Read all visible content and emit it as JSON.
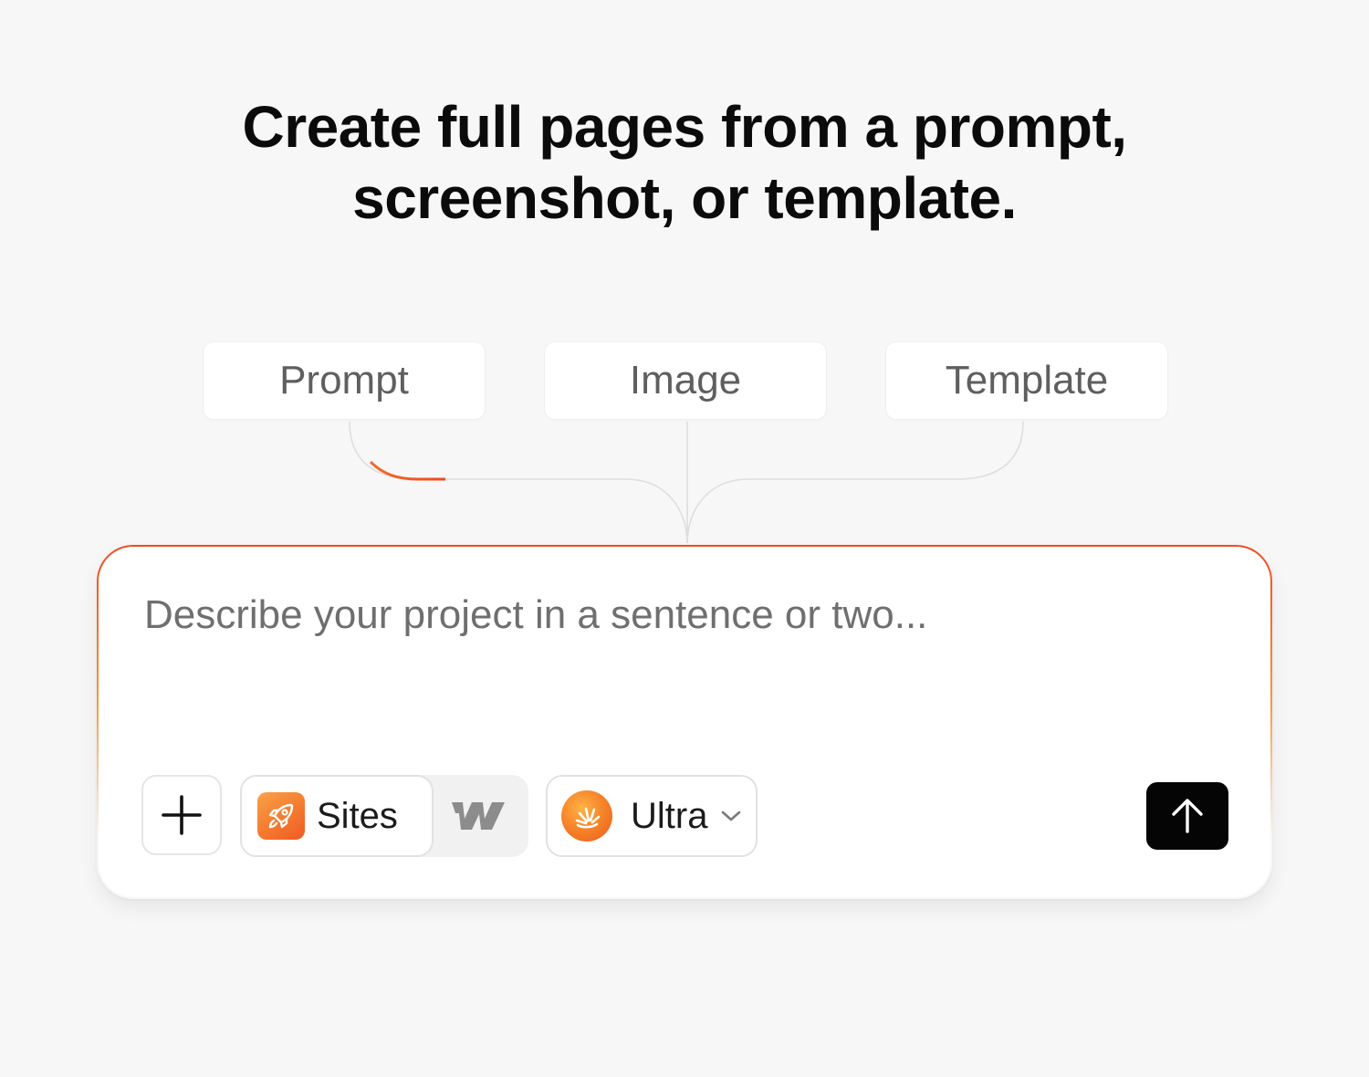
{
  "headline": {
    "line1": "Create full pages from a prompt,",
    "line2": "screenshot, or template."
  },
  "sources": [
    {
      "label": "Prompt"
    },
    {
      "label": "Image"
    },
    {
      "label": "Template"
    }
  ],
  "composer": {
    "placeholder": "Describe your project in a sentence or two...",
    "add_icon": "plus-icon",
    "site_toggle": {
      "selected_label": "Sites",
      "selected_icon": "rocket-icon",
      "other_icon": "webflow-logo-icon"
    },
    "model": {
      "label": "Ultra",
      "icon": "ultra-burst-icon",
      "dropdown_icon": "chevron-down-icon"
    },
    "send_icon": "arrow-up-icon"
  },
  "colors": {
    "accent_red": "#ef4a1f",
    "accent_orange": "#f7862a",
    "background": "#f7f7f7",
    "send_button": "#050505"
  }
}
